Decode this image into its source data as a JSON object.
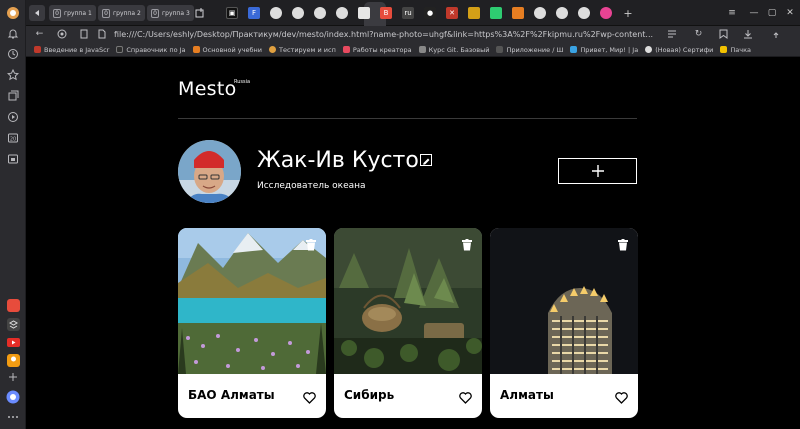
{
  "browser": {
    "tab_groups": [
      {
        "num": "0",
        "label": "группа 1"
      },
      {
        "num": "0",
        "label": "группа 2"
      },
      {
        "num": "0",
        "label": "группа 3"
      }
    ],
    "url": "file:///C:/Users/eshly/Desktop/Практикум/dev/mesto/index.html?name-photo=uhgf&link=https%3A%2F%2Fkipmu.ru%2Fwp-content...",
    "bookmarks": [
      {
        "label": "Введение в JavaScr",
        "color": "#c0392b"
      },
      {
        "label": "Справочник по Ja",
        "color": "#2d2d2d"
      },
      {
        "label": "Основной учебни",
        "color": "#e67e22"
      },
      {
        "label": "Тестируем и исп",
        "color": "#e0a040"
      },
      {
        "label": "Работы креатора",
        "color": "#e84a5f"
      },
      {
        "label": "Курс Git. Базовый",
        "color": "#888888"
      },
      {
        "label": "Приложение / Ш",
        "color": "#555555"
      },
      {
        "label": "Привет, Мир! | Ja",
        "color": "#3aa3e3"
      },
      {
        "label": "(Новая) Сертифи",
        "color": "#dddddd"
      },
      {
        "label": "Пачка",
        "color": "#f2c200"
      }
    ]
  },
  "header": {
    "logo": "Mesto",
    "logo_sup": "Russia"
  },
  "profile": {
    "name": "Жак-Ив Кусто",
    "about": "Исследователь океана",
    "edit_icon": "pencil-icon",
    "add_icon": "plus-icon"
  },
  "cards": [
    {
      "title": "БАО Алматы"
    },
    {
      "title": "Сибирь"
    },
    {
      "title": "Алматы"
    }
  ]
}
